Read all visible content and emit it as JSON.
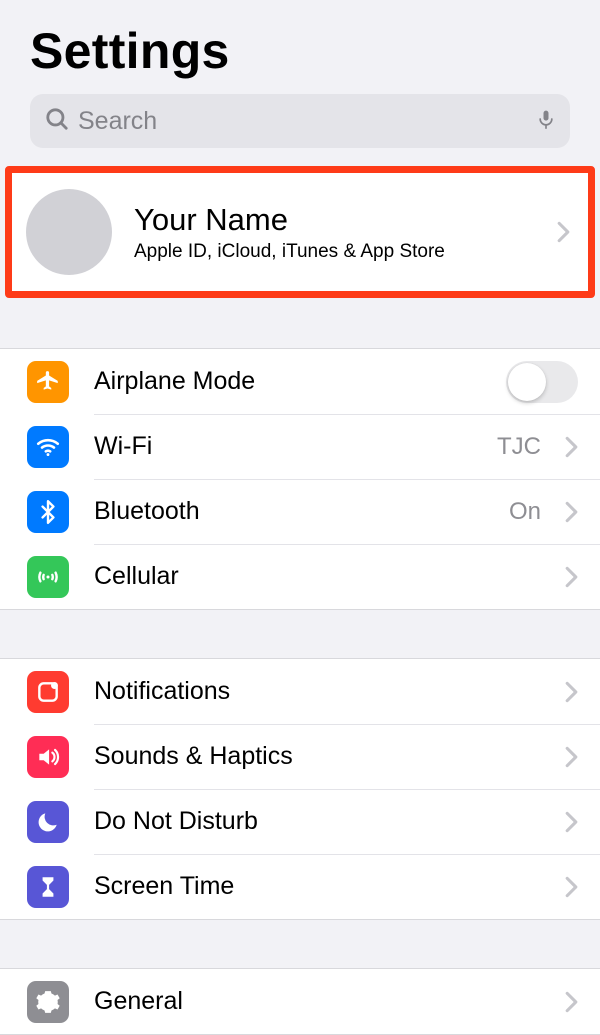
{
  "header": {
    "title": "Settings"
  },
  "search": {
    "placeholder": "Search"
  },
  "profile": {
    "name": "Your Name",
    "subtitle": "Apple ID, iCloud, iTunes & App Store"
  },
  "section1": {
    "airplane": {
      "label": "Airplane Mode",
      "on": false
    },
    "wifi": {
      "label": "Wi-Fi",
      "value": "TJC"
    },
    "bluetooth": {
      "label": "Bluetooth",
      "value": "On"
    },
    "cellular": {
      "label": "Cellular"
    }
  },
  "section2": {
    "notifications": {
      "label": "Notifications"
    },
    "sounds": {
      "label": "Sounds & Haptics"
    },
    "dnd": {
      "label": "Do Not Disturb"
    },
    "screentime": {
      "label": "Screen Time"
    }
  },
  "section3": {
    "general": {
      "label": "General"
    }
  }
}
